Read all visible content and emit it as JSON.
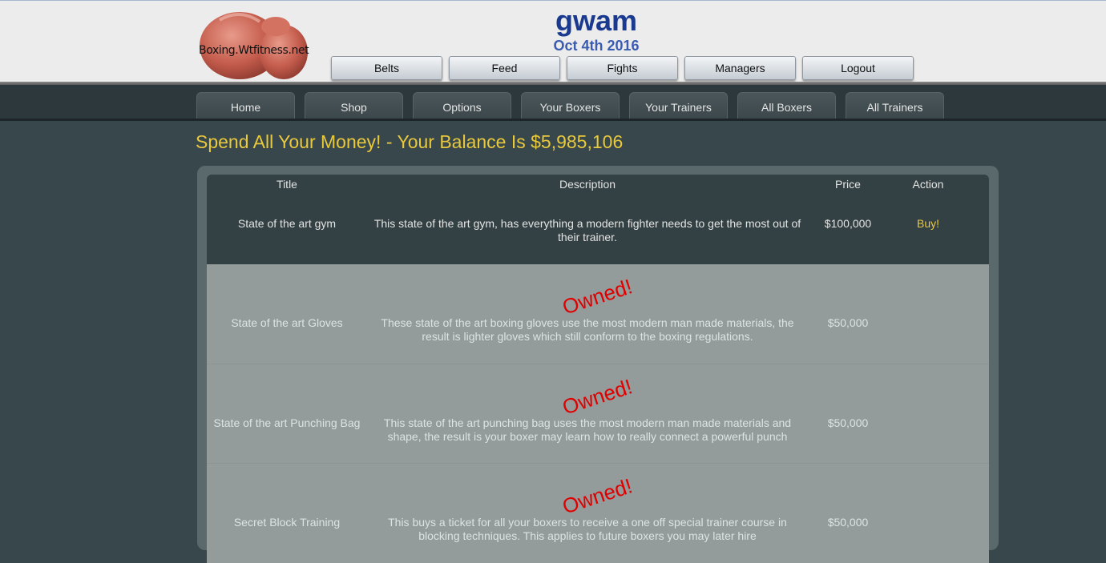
{
  "header": {
    "logo_text": "Boxing.Wtfitness.net",
    "username": "gwam",
    "date": "Oct 4th 2016",
    "nav": [
      "Belts",
      "Feed",
      "Fights",
      "Managers",
      "Logout"
    ]
  },
  "main_nav": [
    "Home",
    "Shop",
    "Options",
    "Your Boxers",
    "Your Trainers",
    "All Boxers",
    "All Trainers"
  ],
  "page": {
    "heading": "Spend All Your Money! - Your Balance Is $5,985,106"
  },
  "table": {
    "columns": [
      "Title",
      "Description",
      "Price",
      "Action"
    ],
    "rows": [
      {
        "title": "State of the art gym",
        "description": "This state of the art gym, has everything a modern fighter needs to get the most out of their trainer.",
        "price": "$100,000",
        "action": "Buy!",
        "owned": false
      },
      {
        "title": "State of the art Gloves",
        "description": "These state of the art boxing gloves use the most modern man made materials, the result is lighter gloves which still conform to the boxing regulations.",
        "price": "$50,000",
        "action": "",
        "owned": true,
        "owned_label": "Owned!"
      },
      {
        "title": "State of the art Punching Bag",
        "description": "This state of the art punching bag uses the most modern man made materials and shape, the result is your boxer may learn how to really connect a powerful punch",
        "price": "$50,000",
        "action": "",
        "owned": true,
        "owned_label": "Owned!"
      },
      {
        "title": "Secret Block Training",
        "description": "This buys a ticket for all your boxers to receive a one off special trainer course in blocking techniques. This applies to future boxers you may later hire",
        "price": "$50,000",
        "action": "",
        "owned": true,
        "owned_label": "Owned!"
      }
    ]
  },
  "colors": {
    "heading": "#e9c93c",
    "owned_stamp": "#e00000",
    "username": "#1a3a8f"
  }
}
